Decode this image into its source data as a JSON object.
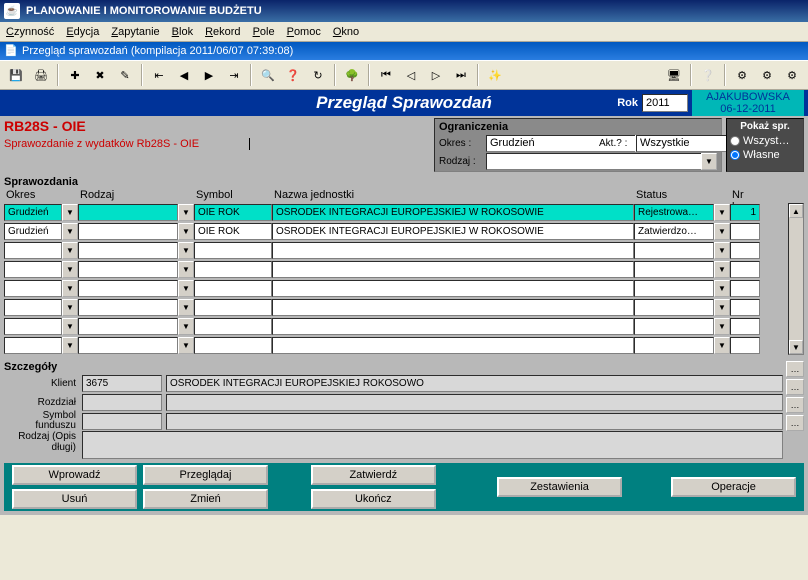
{
  "window": {
    "title": "PLANOWANIE I MONITOROWANIE BUDŻETU"
  },
  "menu": {
    "items": [
      "Czynność",
      "Edycja",
      "Zapytanie",
      "Blok",
      "Rekord",
      "Pole",
      "Pomoc",
      "Okno"
    ]
  },
  "subwindow": {
    "title": "Przegląd sprawozdań (kompilacja 2011/06/07 07:39:08)"
  },
  "toolbar_icons": [
    "save-icon",
    "print-icon",
    "sep",
    "new-icon",
    "delete-icon",
    "edit-icon",
    "sep",
    "first-icon",
    "prev-icon",
    "next-icon",
    "last-icon",
    "sep",
    "filter-icon",
    "find-icon",
    "refresh-icon",
    "sep",
    "tree-icon",
    "sep",
    "nav-first-icon",
    "nav-prev-icon",
    "nav-next-icon",
    "nav-last-icon",
    "sep",
    "wizard-icon"
  ],
  "toolbar_right": [
    "monitor-icon",
    "sep",
    "help-icon",
    "sep",
    "pref1-icon",
    "pref2-icon",
    "pref3-icon"
  ],
  "header": {
    "title": "Przegląd Sprawozdań",
    "rok_label": "Rok",
    "rok_value": "2011",
    "user": "AJAKUBOWSKA",
    "date": "06-12-2011"
  },
  "rb": {
    "heading": "RB28S - OIE",
    "subtitle": "Sprawozdanie z wydatków Rb28S - OIE"
  },
  "ograniczenia": {
    "title": "Ograniczenia",
    "okres_label": "Okres :",
    "okres_value": "Grudzień",
    "akt_label": "Akt.? :",
    "akt_value": "Wszystkie",
    "rodzaj_label": "Rodzaj :",
    "rodzaj_value": ""
  },
  "pokaz": {
    "title": "Pokaż spr.",
    "opt1": "Wszyst…",
    "opt2": "Własne"
  },
  "grid": {
    "section_label": "Sprawozdania",
    "headers": {
      "okres": "Okres",
      "rodzaj": "Rodzaj",
      "symbol": "Symbol",
      "nazwa": "Nazwa jednostki",
      "status": "Status",
      "nrkor": "Nr kor."
    },
    "rows": [
      {
        "okres": "Grudzień",
        "rodzaj": "",
        "symbol": "OIE ROK",
        "nazwa": "OŚRODEK INTEGRACJI EUROPEJSKIEJ W ROKOSOWIE",
        "status": "Rejestrowa…",
        "nrkor": "1",
        "hl": true
      },
      {
        "okres": "Grudzień",
        "rodzaj": "",
        "symbol": "OIE ROK",
        "nazwa": "OŚRODEK INTEGRACJI EUROPEJSKIEJ W ROKOSOWIE",
        "status": "Zatwierdzo…",
        "nrkor": "",
        "hl": false
      },
      {
        "okres": "",
        "rodzaj": "",
        "symbol": "",
        "nazwa": "",
        "status": "",
        "nrkor": "",
        "hl": false
      },
      {
        "okres": "",
        "rodzaj": "",
        "symbol": "",
        "nazwa": "",
        "status": "",
        "nrkor": "",
        "hl": false
      },
      {
        "okres": "",
        "rodzaj": "",
        "symbol": "",
        "nazwa": "",
        "status": "",
        "nrkor": "",
        "hl": false
      },
      {
        "okres": "",
        "rodzaj": "",
        "symbol": "",
        "nazwa": "",
        "status": "",
        "nrkor": "",
        "hl": false
      },
      {
        "okres": "",
        "rodzaj": "",
        "symbol": "",
        "nazwa": "",
        "status": "",
        "nrkor": "",
        "hl": false
      },
      {
        "okres": "",
        "rodzaj": "",
        "symbol": "",
        "nazwa": "",
        "status": "",
        "nrkor": "",
        "hl": false
      }
    ]
  },
  "szczegoly": {
    "title": "Szczegóły",
    "klient_label": "Klient",
    "klient_code": "3675",
    "klient_name": "OŚRODEK INTEGRACJI EUROPEJSKIEJ ROKOSOWO",
    "rozdzial_label": "Rozdział",
    "rozdzial_value": "",
    "symbolf_label": "Symbol funduszu",
    "symbolf_value": "",
    "rodzaj_label": "Rodzaj (Opis długi)",
    "rodzaj_value": ""
  },
  "buttons": {
    "wprowadz": "Wprowadź",
    "usun": "Usuń",
    "przegladaj": "Przeglądaj",
    "zmien": "Zmień",
    "zatwierdz": "Zatwierdź",
    "ukoncz": "Ukończ",
    "zestawienia": "Zestawienia",
    "operacje": "Operacje"
  }
}
